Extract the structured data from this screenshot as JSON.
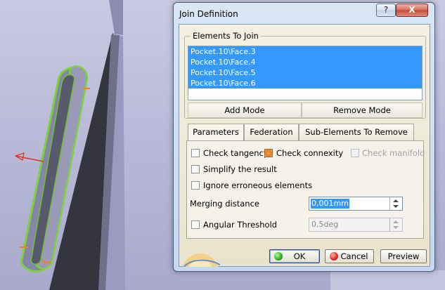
{
  "window": {
    "title": "Join Definition",
    "help_label": "?",
    "close_label": "X"
  },
  "elements_to_join": {
    "legend": "Elements To Join",
    "items": [
      "Pocket.10\\Face.3",
      "Pocket.10\\Face.4",
      "Pocket.10\\Face.5",
      "Pocket.10\\Face.6"
    ],
    "add_mode_label": "Add Mode",
    "remove_mode_label": "Remove Mode"
  },
  "tabs": [
    {
      "label": "Parameters",
      "active": true
    },
    {
      "label": "Federation",
      "active": false
    },
    {
      "label": "Sub-Elements To Remove",
      "active": false
    }
  ],
  "parameters": {
    "check_tangency": {
      "label": "Check tangency",
      "checked": false
    },
    "check_connexity": {
      "label": "Check connexity",
      "checked": true
    },
    "check_manifold": {
      "label": "Check manifold",
      "checked": false,
      "disabled": true
    },
    "simplify_result": {
      "label": "Simplify the result",
      "checked": false
    },
    "ignore_erroneous": {
      "label": "Ignore erroneous elements",
      "checked": false
    },
    "merging_distance": {
      "label": "Merging distance",
      "value": "0,001mm"
    },
    "angular_threshold": {
      "label": "Angular Threshold",
      "checked": false,
      "value": "0,5deg",
      "disabled": true
    }
  },
  "buttons": {
    "ok_label": "OK",
    "cancel_label": "Cancel",
    "preview_label": "Preview"
  },
  "colors": {
    "selection": "#3399ff",
    "part_outline": "#7bd23a",
    "part_fill": "#7e7ea6"
  }
}
